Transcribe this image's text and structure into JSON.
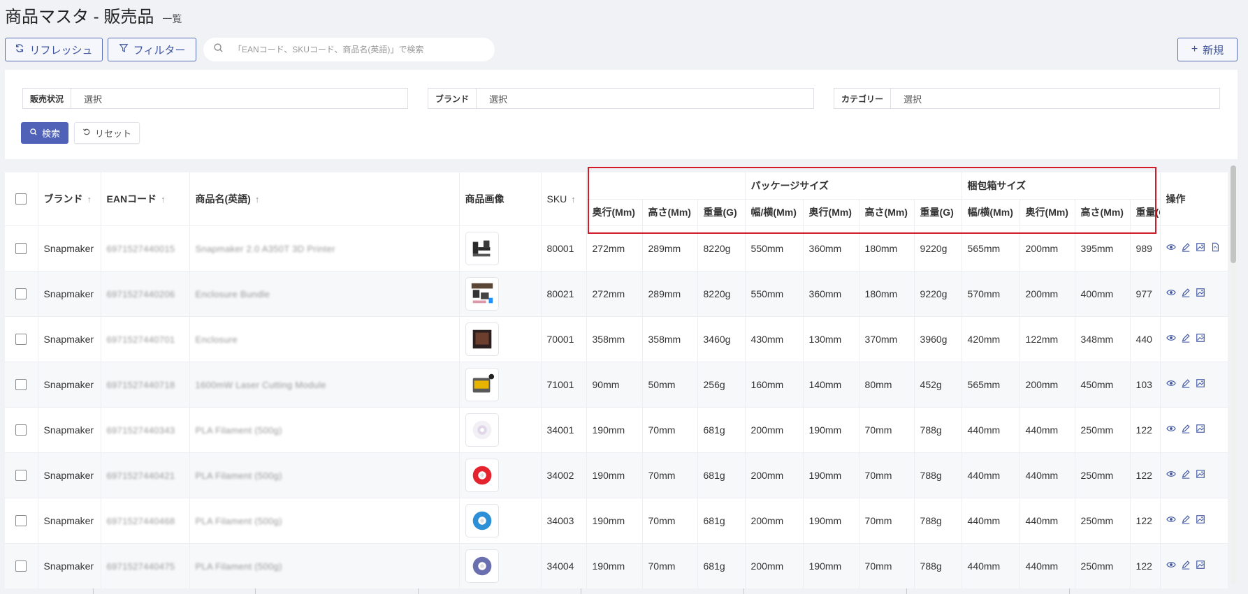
{
  "header": {
    "title": "商品マスタ - 販売品",
    "subtitle": "一覧"
  },
  "toolbar": {
    "refresh_label": "リフレッシュ",
    "filter_label": "フィルター",
    "search_placeholder": "「EANコード、SKUコード、商品名(英語)」で検索",
    "new_label": "新規"
  },
  "filters": {
    "status_label": "販売状況",
    "status_value": "選択",
    "brand_label": "ブランド",
    "brand_value": "選択",
    "category_label": "カテゴリー",
    "category_value": "選択",
    "search_button": "検索",
    "reset_button": "リセット"
  },
  "table": {
    "columns": {
      "brand": "ブランド",
      "ean": "EANコード",
      "name": "商品名(英語)",
      "image": "商品画像",
      "sku": "SKU",
      "package_group": "パッケージサイズ",
      "carton_group": "梱包箱サイズ",
      "depth": "奥行(Mm)",
      "height": "高さ(Mm)",
      "weight": "重量(G)",
      "width": "幅/横(Mm)",
      "ops": "操作",
      "sort_glyph": "↑"
    },
    "rows": [
      {
        "brand": "Snapmaker",
        "ean": "6971527440015",
        "name": "Snapmaker 2.0 A350T 3D Printer",
        "sku": "80001",
        "p_depth": "272mm",
        "p_height": "289mm",
        "p_weight": "8220g",
        "pk_width": "550mm",
        "pk_depth": "360mm",
        "pk_height": "180mm",
        "pk_weight": "9220g",
        "c_width": "565mm",
        "c_depth": "200mm",
        "c_height": "395mm",
        "c_weight": "989",
        "img": "printer",
        "pdf": true
      },
      {
        "brand": "Snapmaker",
        "ean": "6971527440206",
        "name": "Enclosure Bundle",
        "sku": "80021",
        "p_depth": "272mm",
        "p_height": "289mm",
        "p_weight": "8220g",
        "pk_width": "550mm",
        "pk_depth": "360mm",
        "pk_height": "180mm",
        "pk_weight": "9220g",
        "c_width": "570mm",
        "c_depth": "200mm",
        "c_height": "400mm",
        "c_weight": "977",
        "img": "bundle",
        "pdf": false
      },
      {
        "brand": "Snapmaker",
        "ean": "6971527440701",
        "name": "Enclosure",
        "sku": "70001",
        "p_depth": "358mm",
        "p_height": "358mm",
        "p_weight": "3460g",
        "pk_width": "430mm",
        "pk_depth": "130mm",
        "pk_height": "370mm",
        "pk_weight": "3960g",
        "c_width": "420mm",
        "c_depth": "122mm",
        "c_height": "348mm",
        "c_weight": "440",
        "img": "box",
        "pdf": false
      },
      {
        "brand": "Snapmaker",
        "ean": "6971527440718",
        "name": "1600mW Laser Cutting Module",
        "sku": "71001",
        "p_depth": "90mm",
        "p_height": "50mm",
        "p_weight": "256g",
        "pk_width": "160mm",
        "pk_depth": "140mm",
        "pk_height": "80mm",
        "pk_weight": "452g",
        "c_width": "565mm",
        "c_depth": "200mm",
        "c_height": "450mm",
        "c_weight": "103",
        "img": "module",
        "pdf": false
      },
      {
        "brand": "Snapmaker",
        "ean": "6971527440343",
        "name": "PLA Filament (500g)",
        "sku": "34001",
        "p_depth": "190mm",
        "p_height": "70mm",
        "p_weight": "681g",
        "pk_width": "200mm",
        "pk_depth": "190mm",
        "pk_height": "70mm",
        "pk_weight": "788g",
        "c_width": "440mm",
        "c_depth": "440mm",
        "c_height": "250mm",
        "c_weight": "122",
        "img": "spool-white",
        "pdf": false
      },
      {
        "brand": "Snapmaker",
        "ean": "6971527440421",
        "name": "PLA Filament (500g)",
        "sku": "34002",
        "p_depth": "190mm",
        "p_height": "70mm",
        "p_weight": "681g",
        "pk_width": "200mm",
        "pk_depth": "190mm",
        "pk_height": "70mm",
        "pk_weight": "788g",
        "c_width": "440mm",
        "c_depth": "440mm",
        "c_height": "250mm",
        "c_weight": "122",
        "img": "spool-red",
        "pdf": false
      },
      {
        "brand": "Snapmaker",
        "ean": "6971527440468",
        "name": "PLA Filament (500g)",
        "sku": "34003",
        "p_depth": "190mm",
        "p_height": "70mm",
        "p_weight": "681g",
        "pk_width": "200mm",
        "pk_depth": "190mm",
        "pk_height": "70mm",
        "pk_weight": "788g",
        "c_width": "440mm",
        "c_depth": "440mm",
        "c_height": "250mm",
        "c_weight": "122",
        "img": "spool-blue",
        "pdf": false
      },
      {
        "brand": "Snapmaker",
        "ean": "6971527440475",
        "name": "PLA Filament (500g)",
        "sku": "34004",
        "p_depth": "190mm",
        "p_height": "70mm",
        "p_weight": "681g",
        "pk_width": "200mm",
        "pk_depth": "190mm",
        "pk_height": "70mm",
        "pk_weight": "788g",
        "c_width": "440mm",
        "c_depth": "440mm",
        "c_height": "250mm",
        "c_weight": "122",
        "img": "spool-purple",
        "pdf": false
      }
    ]
  },
  "colors": {
    "accent": "#4f62b8",
    "highlight": "#d11a2a",
    "icon": "#3d54a0"
  }
}
